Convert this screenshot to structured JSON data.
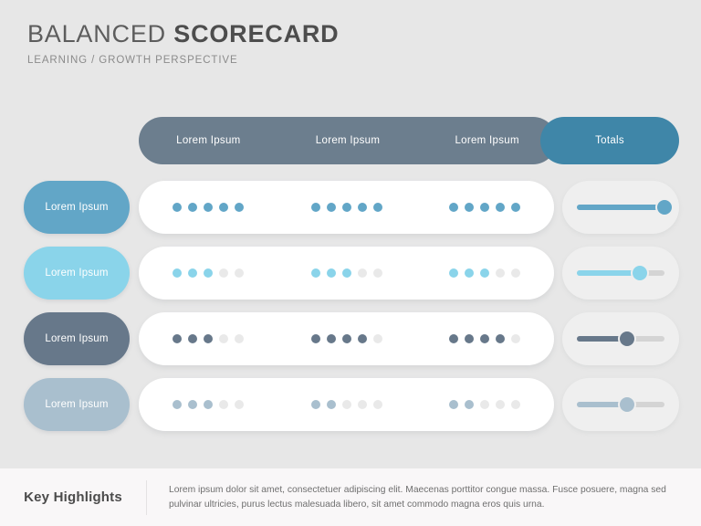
{
  "header": {
    "title_light": "BALANCED",
    "title_bold": "SCORECARD",
    "subtitle": "LEARNING / GROWTH PERSPECTIVE"
  },
  "columns": {
    "col1": "Lorem Ipsum",
    "col2": "Lorem Ipsum",
    "col3": "Lorem Ipsum",
    "totals": "Totals"
  },
  "colors": {
    "background": "#e7e7e7",
    "header_gray": "#6c7e8e",
    "header_blue": "#3f86a8",
    "row1": "#62a6c7",
    "row2": "#8ad4ea",
    "row3": "#67788a",
    "row4": "#a9bfce",
    "dot_empty": "#e9e9e9",
    "slider_track": "#d4d4d4",
    "footer_bg": "#f9f7f8"
  },
  "rows": [
    {
      "label": "Lorem Ipsum",
      "color": "#62a6c7",
      "dots": [
        5,
        5,
        5
      ],
      "dots_total": 5,
      "progress": 100
    },
    {
      "label": "Lorem Ipsum",
      "color": "#8ad4ea",
      "dots": [
        3,
        3,
        3
      ],
      "dots_total": 5,
      "progress": 72
    },
    {
      "label": "Lorem Ipsum",
      "color": "#67788a",
      "dots": [
        3,
        4,
        4
      ],
      "dots_total": 5,
      "progress": 57
    },
    {
      "label": "Lorem Ipsum",
      "color": "#a9bfce",
      "dots": [
        3,
        2,
        2
      ],
      "dots_total": 5,
      "progress": 57
    }
  ],
  "footer": {
    "title": "Key Highlights",
    "text": "Lorem ipsum dolor sit amet, consectetuer adipiscing elit. Maecenas porttitor congue massa. Fusce posuere, magna sed pulvinar ultricies, purus lectus malesuada libero, sit amet commodo magna eros quis urna."
  }
}
